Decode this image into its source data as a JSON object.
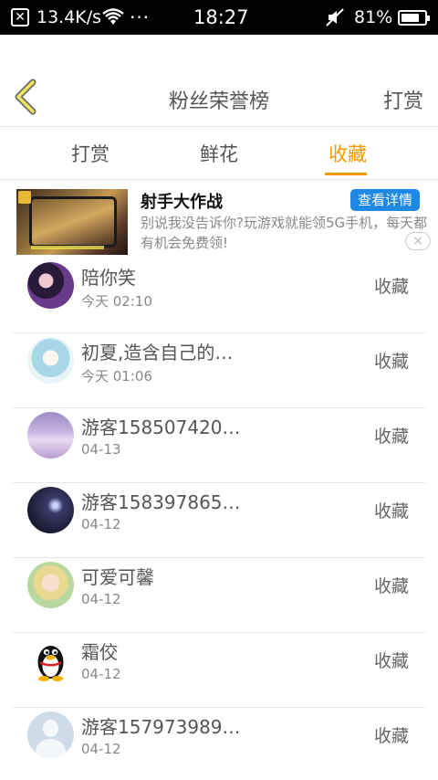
{
  "status_bar": {
    "speed": "13.4K/s",
    "dots": "···",
    "time": "18:27",
    "battery_percent": "81%",
    "battery_level": 0.81
  },
  "header": {
    "title": "粉丝荣誉榜",
    "right_link": "打赏"
  },
  "tabs": [
    {
      "label": "打赏",
      "active": false
    },
    {
      "label": "鲜花",
      "active": false
    },
    {
      "label": "收藏",
      "active": true
    }
  ],
  "accent_color": "#f39800",
  "ad": {
    "title": "射手大作战",
    "button_label": "查看详情",
    "description": "别说我没告诉你?玩游戏就能领5G手机，每天都有机会免费领!",
    "close_symbol": "×"
  },
  "list": [
    {
      "name": "陪你笑",
      "time": "今天 02:10",
      "action": "收藏",
      "avatar": "photo-avatar"
    },
    {
      "name": "初夏,造含自己的…",
      "time": "今天 01:06",
      "action": "收藏",
      "avatar": "anime-avatar"
    },
    {
      "name": "游客158507420…",
      "time": "04-13",
      "action": "收藏",
      "avatar": "landscape-avatar"
    },
    {
      "name": "游客158397865…",
      "time": "04-12",
      "action": "收藏",
      "avatar": "galaxy-avatar"
    },
    {
      "name": "可爱可馨",
      "time": "04-12",
      "action": "收藏",
      "avatar": "photo-avatar"
    },
    {
      "name": "霜佼",
      "time": "04-12",
      "action": "收藏",
      "avatar": "qq-penguin-avatar"
    },
    {
      "name": "游客157973989…",
      "time": "04-12",
      "action": "收藏",
      "avatar": "default-user-avatar"
    }
  ]
}
